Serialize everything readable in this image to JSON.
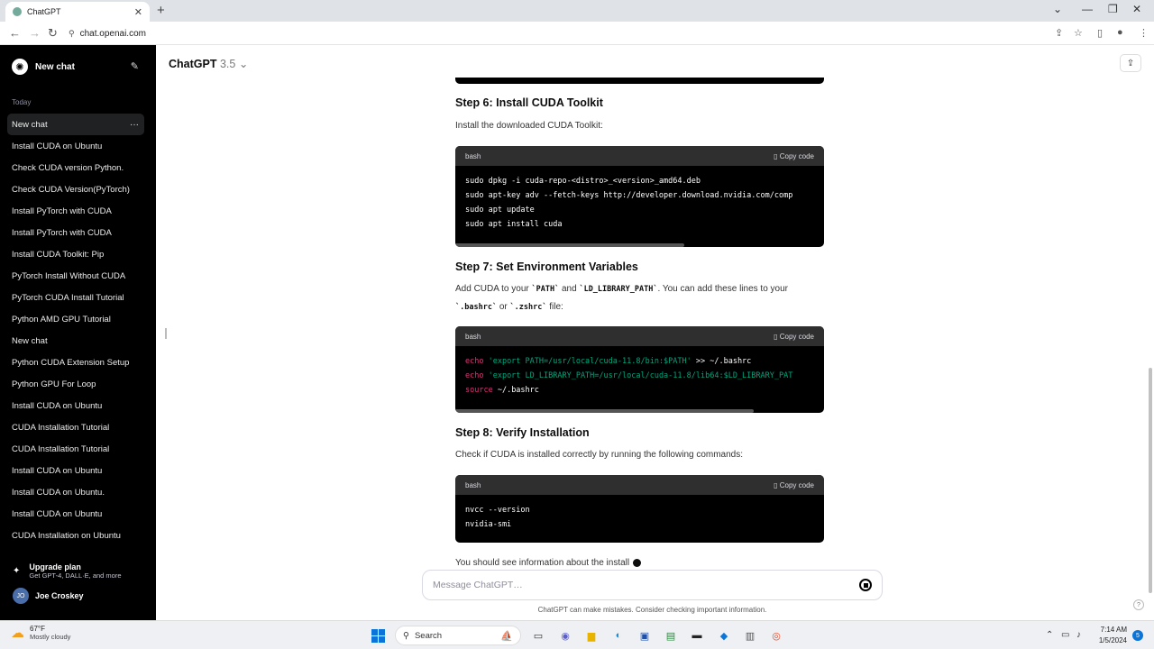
{
  "browser": {
    "tab_title": "ChatGPT",
    "url": "chat.openai.com"
  },
  "sidebar": {
    "new_chat": "New chat",
    "section": "Today",
    "items": [
      {
        "label": "New chat"
      },
      {
        "label": "Install CUDA on Ubuntu"
      },
      {
        "label": "Check CUDA version Python."
      },
      {
        "label": "Check CUDA Version(PyTorch)"
      },
      {
        "label": "Install PyTorch with CUDA"
      },
      {
        "label": "Install PyTorch with CUDA"
      },
      {
        "label": "Install CUDA Toolkit: Pip"
      },
      {
        "label": "PyTorch Install Without CUDA"
      },
      {
        "label": "PyTorch CUDA Install Tutorial"
      },
      {
        "label": "Python AMD GPU Tutorial"
      },
      {
        "label": "New chat"
      },
      {
        "label": "Python CUDA Extension Setup"
      },
      {
        "label": "Python GPU For Loop"
      },
      {
        "label": "Install CUDA on Ubuntu"
      },
      {
        "label": "CUDA Installation Tutorial"
      },
      {
        "label": "CUDA Installation Tutorial"
      },
      {
        "label": "Install CUDA on Ubuntu"
      },
      {
        "label": "Install CUDA on Ubuntu."
      },
      {
        "label": "Install CUDA on Ubuntu"
      },
      {
        "label": "CUDA Installation on Ubuntu"
      }
    ],
    "upgrade_title": "Upgrade plan",
    "upgrade_sub": "Get GPT-4, DALL·E, and more",
    "user_initials": "JO",
    "user_name": "Joe Croskey"
  },
  "header": {
    "model": "ChatGPT",
    "version": "3.5"
  },
  "conversation": {
    "step6_title": "Step 6: Install CUDA Toolkit",
    "step6_text": "Install the downloaded CUDA Toolkit:",
    "step7_title": "Step 7: Set Environment Variables",
    "step7_text_a": "Add CUDA to your ",
    "step7_code_path": "`PATH`",
    "step7_text_b": " and ",
    "step7_code_ld": "`LD_LIBRARY_PATH`",
    "step7_text_c": ". You can add these lines to your",
    "step7_code_bashrc": "`.bashrc`",
    "step7_text_d": " or ",
    "step7_code_zshrc": "`.zshrc`",
    "step7_text_e": " file:",
    "step8_title": "Step 8: Verify Installation",
    "step8_text": "Check if CUDA is installed correctly by running the following commands:",
    "trailing_text": "You should see information about the install",
    "code_lang": "bash",
    "copy_label": "Copy code",
    "code1": [
      "sudo dpkg -i cuda-repo-<distro>_<version>_amd64.deb",
      "sudo apt-key adv --fetch-keys http://developer.download.nvidia.com/comp",
      "sudo apt update",
      "sudo apt install cuda"
    ],
    "code2": [
      {
        "cmd": "echo ",
        "str": "'export PATH=/usr/local/cuda-11.8/bin:$PATH'",
        "rest": " >> ~/.bashrc"
      },
      {
        "cmd": "echo ",
        "str": "'export LD_LIBRARY_PATH=/usr/local/cuda-11.8/lib64:$LD_LIBRARY_PAT",
        "rest": ""
      },
      {
        "cmd": "source",
        "str": "",
        "rest": " ~/.bashrc"
      }
    ],
    "code3": [
      "nvcc --version",
      "nvidia-smi"
    ],
    "code1_scroll_fraction": 0.62,
    "code2_scroll_fraction": 0.81
  },
  "composer": {
    "placeholder": "Message ChatGPT…",
    "disclaimer": "ChatGPT can make mistakes. Consider checking important information."
  },
  "taskbar": {
    "temp": "67°F",
    "weather": "Mostly cloudy",
    "weather_badge": "1",
    "search": "Search",
    "time": "7:14 AM",
    "date": "1/5/2024",
    "notifications": "5"
  }
}
